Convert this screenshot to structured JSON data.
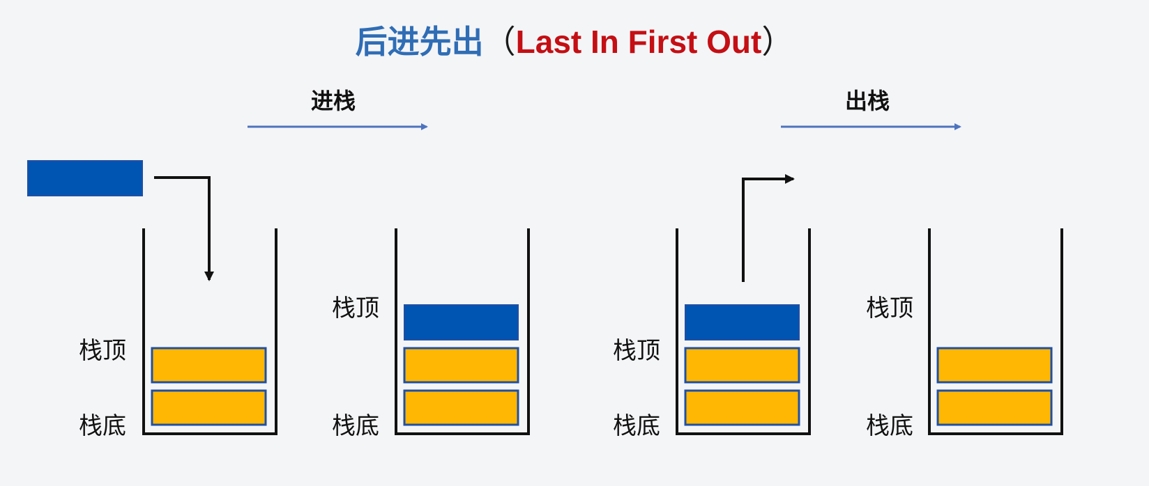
{
  "title": {
    "chinese": "后进先出",
    "open_paren": "（",
    "english": "Last In First Out",
    "close_paren": "）"
  },
  "operations": {
    "push": "进栈",
    "pop": "出栈"
  },
  "labels": {
    "top": "栈顶",
    "bottom": "栈底"
  },
  "colors": {
    "title_cn": "#2f6db5",
    "title_en": "#c40f14",
    "arrow_blue": "#4e73be",
    "new_element": "#0055b3",
    "stored_element": "#ffb703",
    "element_border": "#1f4fa3",
    "stack_wall": "#111111"
  }
}
